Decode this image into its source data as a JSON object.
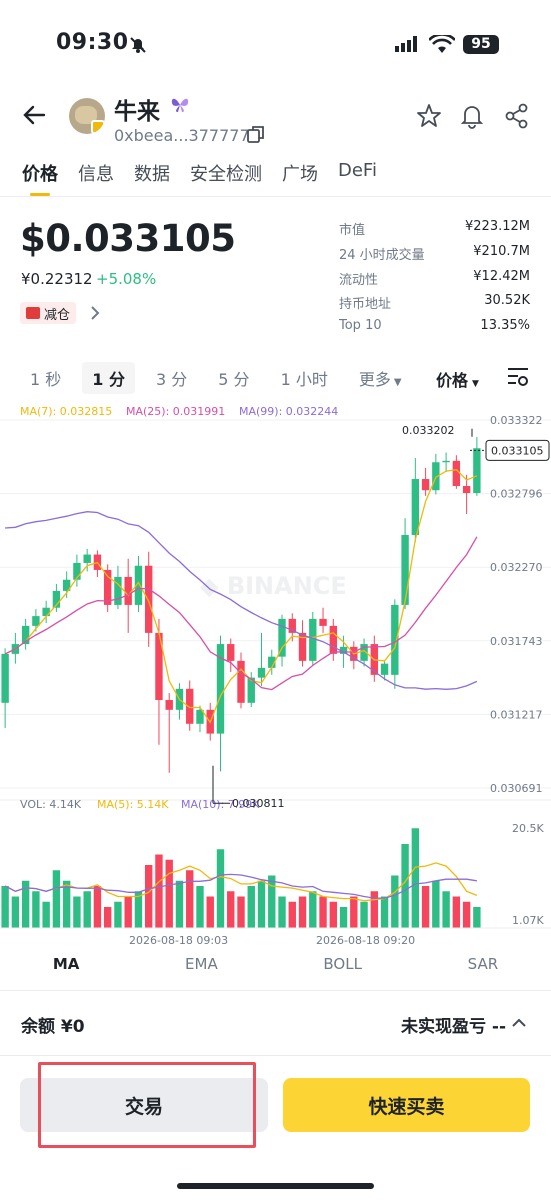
{
  "status": {
    "time": "09:30",
    "battery": "95"
  },
  "token": {
    "name": "牛来",
    "address": "0xbeea...377777"
  },
  "tabs": [
    "价格",
    "信息",
    "数据",
    "安全检测",
    "广场",
    "DeFi"
  ],
  "price": {
    "usd": "$0.033105",
    "cny": "¥0.22312",
    "change": "+5.08%",
    "badge": "减仓"
  },
  "stats": [
    {
      "label": "市值",
      "value": "¥223.12M"
    },
    {
      "label": "24 小时成交量",
      "value": "¥210.7M"
    },
    {
      "label": "流动性",
      "value": "¥12.42M"
    },
    {
      "label": "持币地址",
      "value": "30.52K"
    },
    {
      "label": "Top 10",
      "value": "13.35%"
    }
  ],
  "intervals": [
    "1 秒",
    "1 分",
    "3 分",
    "5 分",
    "1 小时",
    "更多"
  ],
  "price_dropdown": "价格",
  "ma_legend": {
    "ma7": "MA(7): 0.032815",
    "ma25": "MA(25): 0.031991",
    "ma99": "MA(99): 0.032244"
  },
  "vol_legend": {
    "vol": "VOL: 4.14K",
    "ma5": "MA(5): 5.14K",
    "ma10": "MA(10): 7.99K"
  },
  "watermark": "BINANCE",
  "colors": {
    "up": "#2ebd85",
    "down": "#f6465d",
    "ma7": "#f0b90b",
    "ma25": "#d64fa7",
    "ma99": "#8b6cd9",
    "accent": "#fcd535"
  },
  "chart_data": {
    "type": "candlestick",
    "price_ticks": [
      "0.033322",
      "0.032796",
      "0.032270",
      "0.031743",
      "0.031217",
      "0.030691"
    ],
    "high_marker": "0.033202",
    "low_marker": "0.030811",
    "current_price": "0.033105",
    "vol_ticks": [
      "20.5K",
      "1.07K"
    ],
    "time_labels": [
      "2026-08-18 09:03",
      "2026-08-18 09:20"
    ],
    "ylim": [
      0.030691,
      0.033322
    ],
    "candles": [
      [
        0.0313,
        0.03165,
        0.03112,
        0.03169
      ],
      [
        0.03165,
        0.03172,
        0.03158,
        0.0318
      ],
      [
        0.03172,
        0.03185,
        0.03168,
        0.0319
      ],
      [
        0.03185,
        0.03192,
        0.03181,
        0.03197
      ],
      [
        0.03192,
        0.03198,
        0.03187,
        0.03203
      ],
      [
        0.03198,
        0.0321,
        0.03195,
        0.03215
      ],
      [
        0.0321,
        0.03218,
        0.03205,
        0.03224
      ],
      [
        0.03218,
        0.0323,
        0.03213,
        0.03236
      ],
      [
        0.0323,
        0.03236,
        0.03224,
        0.0324
      ],
      [
        0.03236,
        0.03225,
        0.0322,
        0.03239
      ],
      [
        0.03225,
        0.032,
        0.03195,
        0.03229
      ],
      [
        0.032,
        0.0322,
        0.03197,
        0.03228
      ],
      [
        0.0322,
        0.032,
        0.0318,
        0.03233
      ],
      [
        0.032,
        0.03228,
        0.03195,
        0.03235
      ],
      [
        0.03228,
        0.0318,
        0.0317,
        0.03238
      ],
      [
        0.0318,
        0.03132,
        0.031,
        0.0319
      ],
      [
        0.03132,
        0.03125,
        0.0308,
        0.03137
      ],
      [
        0.03125,
        0.0314,
        0.03118,
        0.03144
      ],
      [
        0.0314,
        0.03115,
        0.0311,
        0.03146
      ],
      [
        0.03115,
        0.03125,
        0.03109,
        0.03128
      ],
      [
        0.03125,
        0.03108,
        0.03103,
        0.0313
      ],
      [
        0.03108,
        0.03172,
        0.03081,
        0.03178
      ],
      [
        0.03172,
        0.0316,
        0.03152,
        0.03176
      ],
      [
        0.0316,
        0.0313,
        0.03126,
        0.03166
      ],
      [
        0.0313,
        0.03148,
        0.03127,
        0.03152
      ],
      [
        0.03148,
        0.03155,
        0.03142,
        0.0318
      ],
      [
        0.03155,
        0.03163,
        0.0315,
        0.03168
      ],
      [
        0.03163,
        0.0319,
        0.03156,
        0.03193
      ],
      [
        0.0319,
        0.0318,
        0.03174,
        0.03194
      ],
      [
        0.0318,
        0.0316,
        0.03156,
        0.03189
      ],
      [
        0.0316,
        0.0319,
        0.03157,
        0.03195
      ],
      [
        0.0319,
        0.03185,
        0.0318,
        0.03198
      ],
      [
        0.03185,
        0.03165,
        0.0316,
        0.0319
      ],
      [
        0.03165,
        0.0317,
        0.03155,
        0.03178
      ],
      [
        0.0317,
        0.0316,
        0.03154,
        0.03174
      ],
      [
        0.0316,
        0.03172,
        0.03156,
        0.03176
      ],
      [
        0.03172,
        0.0315,
        0.03145,
        0.03178
      ],
      [
        0.0315,
        0.03158,
        0.03146,
        0.0316
      ],
      [
        0.0315,
        0.032,
        0.0314,
        0.03204
      ],
      [
        0.032,
        0.0325,
        0.03197,
        0.03262
      ],
      [
        0.0325,
        0.0329,
        0.03245,
        0.03305
      ],
      [
        0.0329,
        0.03282,
        0.03278,
        0.03298
      ],
      [
        0.03282,
        0.03302,
        0.03279,
        0.03308
      ],
      [
        0.03302,
        0.03303,
        0.03295,
        0.03309
      ],
      [
        0.03303,
        0.03285,
        0.03283,
        0.03307
      ],
      [
        0.03285,
        0.0328,
        0.03265,
        0.03293
      ],
      [
        0.0328,
        0.03312,
        0.03278,
        0.0332
      ]
    ],
    "volumes": [
      8,
      6,
      9,
      7,
      5,
      11,
      9,
      6,
      7,
      8,
      4,
      5,
      6,
      7,
      12,
      14,
      13,
      9,
      11,
      8,
      6,
      15,
      7,
      6,
      8,
      9,
      10,
      6,
      5,
      6,
      7,
      6,
      5,
      4,
      6,
      5,
      7,
      6,
      10,
      16,
      19,
      8,
      9,
      7,
      6,
      5,
      4
    ]
  },
  "indicators": [
    "MA",
    "EMA",
    "BOLL",
    "SAR"
  ],
  "balance": {
    "label": "余额 ¥0",
    "pnl": "未实现盈亏 --"
  },
  "buttons": {
    "trade": "交易",
    "quick": "快速买卖"
  }
}
